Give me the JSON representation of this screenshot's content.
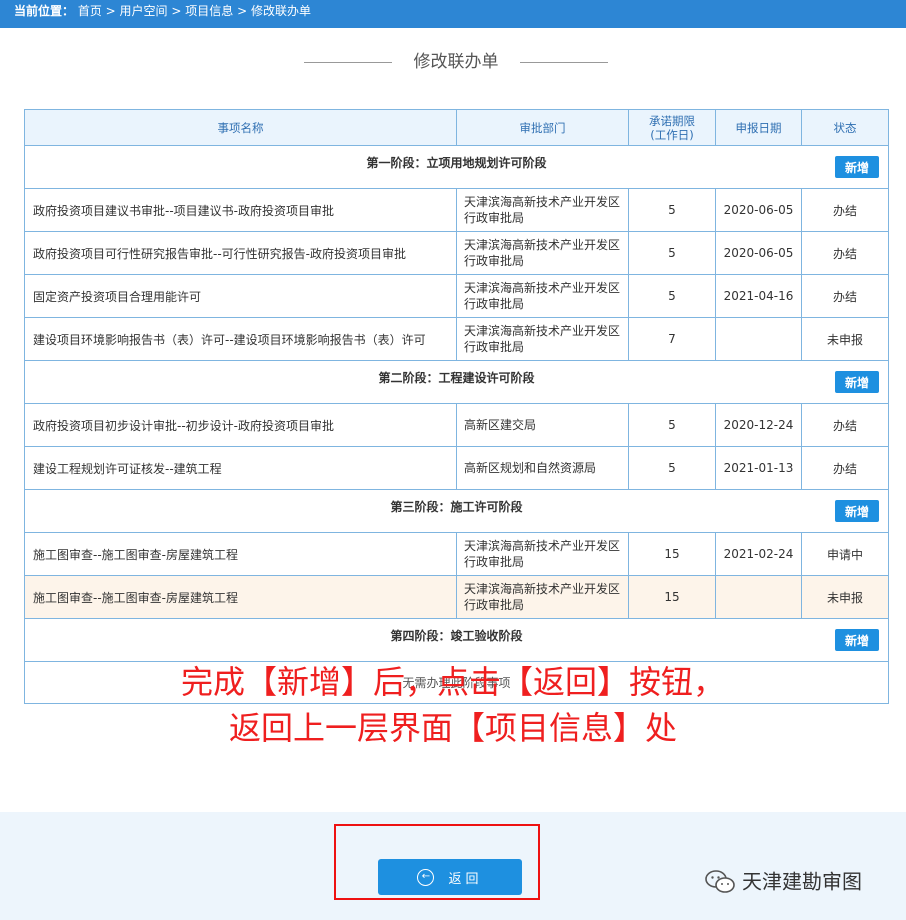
{
  "breadcrumb": {
    "label": "当前位置：",
    "items": [
      "首页",
      "用户空间",
      "项目信息",
      "修改联办单"
    ],
    "sep": " > "
  },
  "page_title": "修改联办单",
  "table": {
    "headers": [
      "事项名称",
      "审批部门",
      "承诺期限(工作日)",
      "申报日期",
      "状态"
    ],
    "header_deadline_l1": "承诺期限",
    "header_deadline_l2": "(工作日)",
    "add_label": "新增",
    "stages": [
      {
        "name": "第一阶段：立项用地规划许可阶段",
        "rows": [
          {
            "name": "政府投资项目建议书审批--项目建议书-政府投资项目审批",
            "dept1": "天津滨海高新技术产业开发区",
            "dept2": "行政审批局",
            "days": "5",
            "date": "2020-06-05",
            "status": "办结"
          },
          {
            "name": "政府投资项目可行性研究报告审批--可行性研究报告-政府投资项目审批",
            "dept1": "天津滨海高新技术产业开发区",
            "dept2": "行政审批局",
            "days": "5",
            "date": "2020-06-05",
            "status": "办结"
          },
          {
            "name": "固定资产投资项目合理用能许可",
            "dept1": "天津滨海高新技术产业开发区",
            "dept2": "行政审批局",
            "days": "5",
            "date": "2021-04-16",
            "status": "办结"
          },
          {
            "name": "建设项目环境影响报告书（表）许可--建设项目环境影响报告书（表）许可",
            "dept1": "天津滨海高新技术产业开发区",
            "dept2": "行政审批局",
            "days": "7",
            "date": "",
            "status": "未申报"
          }
        ]
      },
      {
        "name": "第二阶段：工程建设许可阶段",
        "rows": [
          {
            "name": "政府投资项目初步设计审批--初步设计-政府投资项目审批",
            "dept1": "高新区建交局",
            "dept2": "",
            "days": "5",
            "date": "2020-12-24",
            "status": "办结"
          },
          {
            "name": "建设工程规划许可证核发--建筑工程",
            "dept1": "高新区规划和自然资源局",
            "dept2": "",
            "days": "5",
            "date": "2021-01-13",
            "status": "办结"
          }
        ]
      },
      {
        "name": "第三阶段：施工许可阶段",
        "rows": [
          {
            "name": "施工图审查--施工图审查-房屋建筑工程",
            "dept1": "天津滨海高新技术产业开发区",
            "dept2": "行政审批局",
            "days": "15",
            "date": "2021-02-24",
            "status": "申请中"
          },
          {
            "name": "施工图审查--施工图审查-房屋建筑工程",
            "dept1": "天津滨海高新技术产业开发区",
            "dept2": "行政审批局",
            "days": "15",
            "date": "",
            "status": "未申报"
          }
        ]
      },
      {
        "name": "第四阶段：竣工验收阶段",
        "empty_text": "无需办理此阶段事项",
        "rows": []
      }
    ]
  },
  "annotation": {
    "line1": "完成【新增】后，点击【返回】按钮，",
    "line2": "返回上一层界面【项目信息】处"
  },
  "back_button": {
    "label": "返回"
  },
  "watermark": {
    "text": "天津建勘审图"
  },
  "colors": {
    "topbar": "#2d86d4",
    "accent": "#1e90e0",
    "annotation": "#ef1f1f",
    "highlight_row": "#fdf4ea"
  }
}
